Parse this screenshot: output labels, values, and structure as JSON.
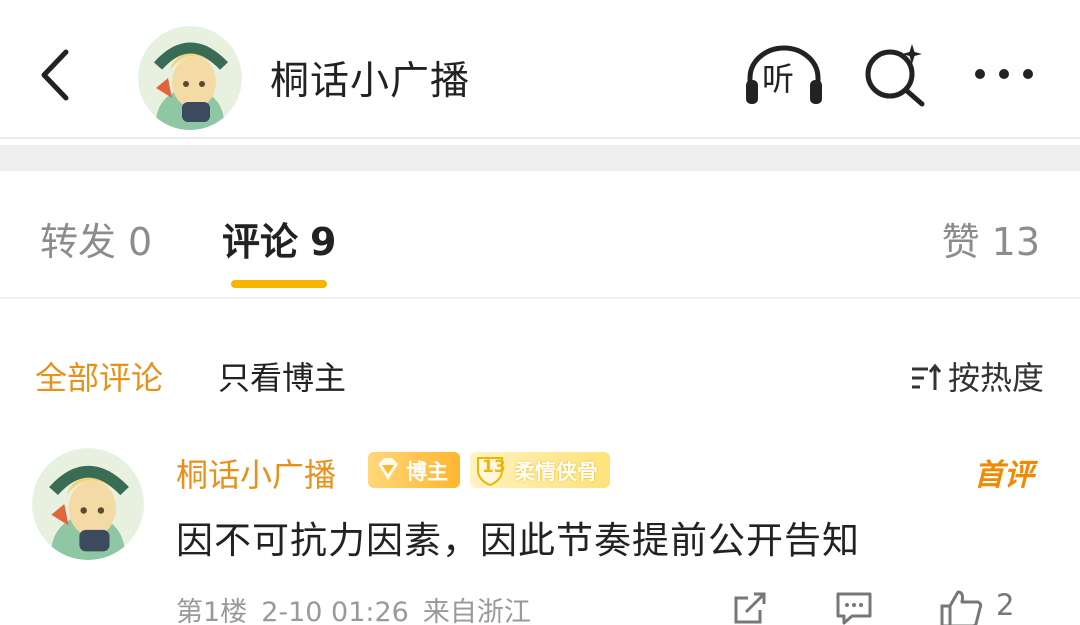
{
  "header": {
    "title": "桐话小广播",
    "listen_label": "听",
    "avatar_logo_text": "桐话小广播"
  },
  "tabs": [
    {
      "label": "转发",
      "count": "0"
    },
    {
      "label": "评论",
      "count": "9"
    },
    {
      "label": "赞",
      "count": "13"
    }
  ],
  "filters": {
    "all_label": "全部评论",
    "author_only_label": "只看博主",
    "sort_label": "按热度"
  },
  "comment": {
    "author": "桐话小广播",
    "badge_author": "博主",
    "badge_level_num": "13",
    "badge_level_name": "柔情侠骨",
    "tag": "首评",
    "text": "因不可抗力因素，因此节奏提前公开告知",
    "floor": "第1楼",
    "time": "2-10 01:26",
    "location": "来自浙江",
    "like_count": "2"
  },
  "colors": {
    "accent_orange": "#e9901a",
    "tab_underline": "#f7b500",
    "muted_text": "#8c8c8c"
  },
  "icons": [
    "back-arrow-icon",
    "headphones-icon",
    "search-sparkle-icon",
    "more-dots-icon",
    "sort-icon",
    "share-icon",
    "reply-icon",
    "thumbs-up-icon"
  ]
}
